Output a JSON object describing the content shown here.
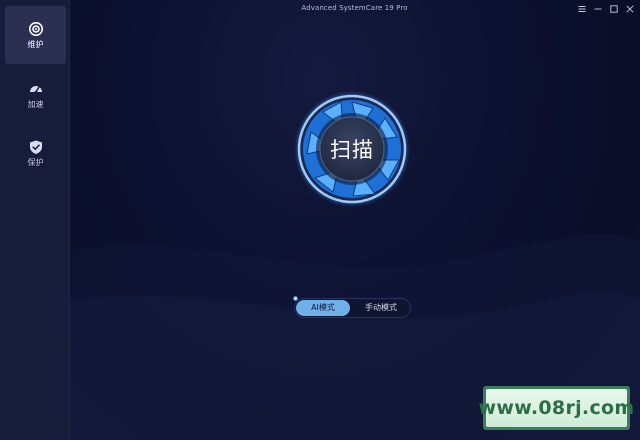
{
  "window": {
    "title": "Advanced SystemCare 19 Pro"
  },
  "sidebar": {
    "items": [
      {
        "label": "维护",
        "icon": "maintenance-icon",
        "active": true
      },
      {
        "label": "加速",
        "icon": "speedometer-icon",
        "active": false
      },
      {
        "label": "保护",
        "icon": "shield-icon",
        "active": false
      }
    ]
  },
  "window_controls": [
    "menu-icon",
    "minimize-icon",
    "maximize-icon",
    "close-icon"
  ],
  "scan": {
    "label": "扫描"
  },
  "mode": {
    "ai_label": "AI模式",
    "manual_label": "手动模式",
    "selected": "AI模式"
  },
  "watermark": {
    "text": "www.08rj.com"
  },
  "colors": {
    "background": "#0c1130",
    "sidebar": "#171c3b",
    "accent": "#4a9ff0",
    "mode_active": "#6fb0e8",
    "watermark_green": "#3b7f5a"
  }
}
